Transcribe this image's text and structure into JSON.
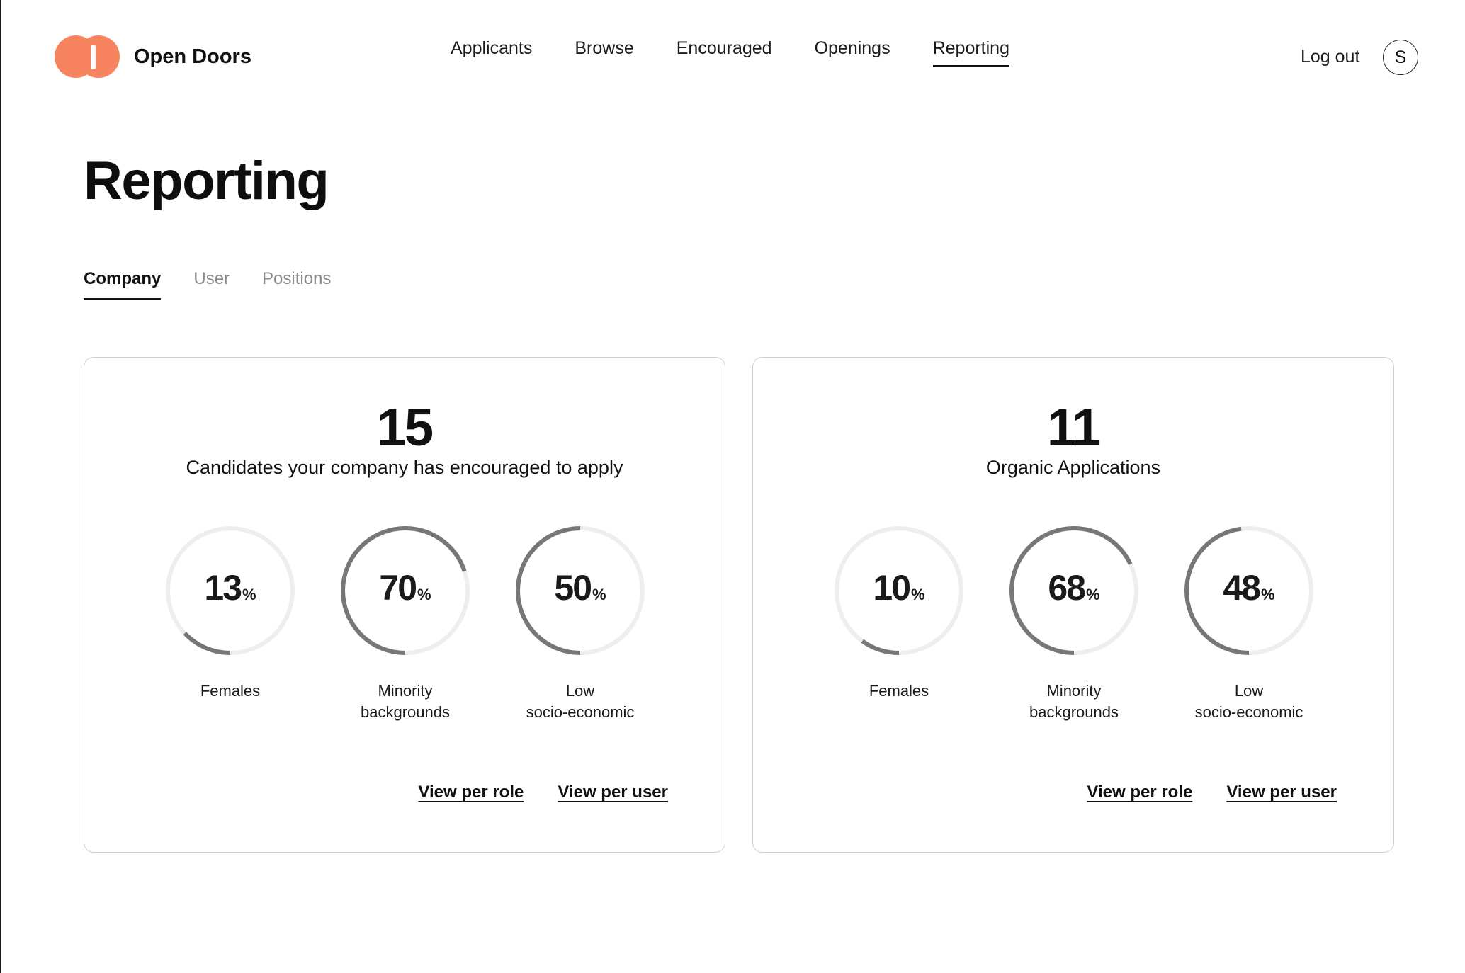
{
  "brand": {
    "name": "Open Doors",
    "logo_color": "#f7845e"
  },
  "nav": {
    "items": [
      "Applicants",
      "Browse",
      "Encouraged",
      "Openings",
      "Reporting"
    ],
    "active": "Reporting",
    "logout_label": "Log out",
    "avatar_initial": "S"
  },
  "page": {
    "title": "Reporting"
  },
  "tabs": {
    "items": [
      "Company",
      "User",
      "Positions"
    ],
    "active": "Company"
  },
  "cards": [
    {
      "number": "15",
      "caption": "Candidates your company has encouraged to apply",
      "stats": [
        {
          "value": 13,
          "label": "Females"
        },
        {
          "value": 70,
          "label": "Minority\nbackgrounds"
        },
        {
          "value": 50,
          "label": "Low\nsocio-economic"
        }
      ],
      "links": [
        "View per role",
        "View per user"
      ]
    },
    {
      "number": "11",
      "caption": "Organic Applications",
      "stats": [
        {
          "value": 10,
          "label": "Females"
        },
        {
          "value": 68,
          "label": "Minority\nbackgrounds"
        },
        {
          "value": 48,
          "label": "Low\nsocio-economic"
        }
      ],
      "links": [
        "View per role",
        "View per user"
      ]
    }
  ],
  "percent_sign": "%",
  "colors": {
    "ring_track": "#eeeeee",
    "ring_fill": "#777777"
  }
}
